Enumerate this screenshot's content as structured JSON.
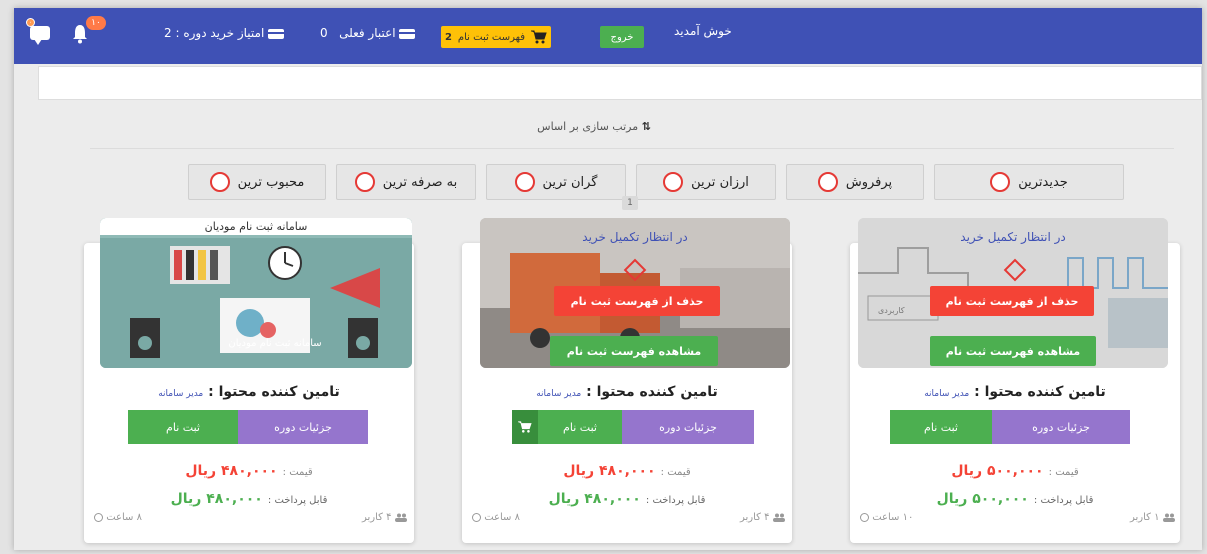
{
  "header": {
    "notification_badge": "۱۰",
    "chat_badge": "۰",
    "course_points_label": "امتیاز خرید دوره : 2",
    "current_credit_label": "اعتبار فعلی",
    "current_credit_value": "0",
    "cart_label": "فهرست ثبت نام",
    "cart_count": "2",
    "logout_label": "خروج",
    "welcome": "خوش آمدید"
  },
  "sort": {
    "label": "مرتب سازی بر اساس",
    "options": [
      "جدیدترین",
      "پرفروش",
      "ارزان ترین",
      "گران ترین",
      "به صرفه ترین",
      "محبوب ترین"
    ],
    "page": "1"
  },
  "courses": [
    {
      "status": "در انتظار تکمیل خرید",
      "remove_label": "حذف از فهرست ثبت نام",
      "view_label": "مشاهده فهرست ثبت نام",
      "provider_label": "تامین کننده محتوا :",
      "provider_name": "مدیر سامانه",
      "details_label": "جزئیات دوره",
      "register_label": "ثبت نام",
      "price_label": "قیمت :",
      "price_value": "۵۰۰,۰۰۰ ریال",
      "pay_label": "قابل پرداخت :",
      "pay_value": "۵۰۰,۰۰۰ ریال",
      "users": "۱ کاربر",
      "hours": "۱۰ ساعت"
    },
    {
      "status": "در انتظار تکمیل خرید",
      "remove_label": "حذف از فهرست ثبت نام",
      "view_label": "مشاهده فهرست ثبت نام",
      "provider_label": "تامین کننده محتوا :",
      "provider_name": "مدیر سامانه",
      "details_label": "جزئیات دوره",
      "register_label": "ثبت نام",
      "price_label": "قیمت :",
      "price_value": "۴۸۰,۰۰۰ ریال",
      "pay_label": "قابل پرداخت :",
      "pay_value": "۴۸۰,۰۰۰ ریال",
      "users": "۴ کاربر",
      "hours": "۸ ساعت"
    },
    {
      "thumb_title": "سامانه ثبت نام مودیان",
      "thumb_overlay": "سامانه ثبت نام مودیان",
      "provider_label": "تامین کننده محتوا :",
      "provider_name": "مدیر سامانه",
      "details_label": "جزئیات دوره",
      "register_label": "ثبت نام",
      "price_label": "قیمت :",
      "price_value": "۴۸۰,۰۰۰ ریال",
      "pay_label": "قابل پرداخت :",
      "pay_value": "۴۸۰,۰۰۰ ریال",
      "users": "۴ کاربر",
      "hours": "۸ ساعت"
    }
  ],
  "colors": {
    "topbar": "#3f51b5",
    "cart": "#fec107",
    "green": "#4caf50",
    "red": "#f44336",
    "purple": "#9575cd"
  }
}
